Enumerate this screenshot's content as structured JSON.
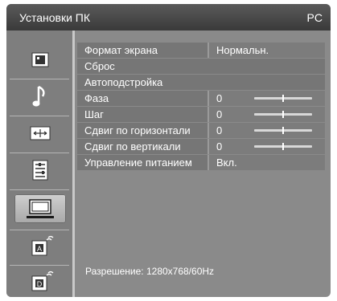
{
  "title": {
    "left": "Установки ПК",
    "right": "PC"
  },
  "sidebar": {
    "items": [
      {
        "name": "picture-icon"
      },
      {
        "name": "music-note-icon"
      },
      {
        "name": "screen-size-icon"
      },
      {
        "name": "settings-list-icon"
      },
      {
        "name": "pc-monitor-icon",
        "active": true
      },
      {
        "name": "analog-input-icon"
      },
      {
        "name": "digital-input-icon"
      }
    ]
  },
  "menu": {
    "rows": [
      {
        "label": "Формат экрана",
        "value": "Нормальн."
      },
      {
        "label": "Сброс",
        "value": ""
      },
      {
        "label": "Автоподстройка",
        "value": ""
      },
      {
        "label": "Фаза",
        "value": "0",
        "slider": 0.5
      },
      {
        "label": "Шаг",
        "value": "0",
        "slider": 0.5
      },
      {
        "label": "Сдвиг по горизонтали",
        "value": "0",
        "slider": 0.5
      },
      {
        "label": "Сдвиг по вертикали",
        "value": "0",
        "slider": 0.5
      },
      {
        "label": "Управление питанием",
        "value": "Вкл."
      }
    ]
  },
  "footer": {
    "resolution": "Разрешение: 1280x768/60Hz"
  }
}
